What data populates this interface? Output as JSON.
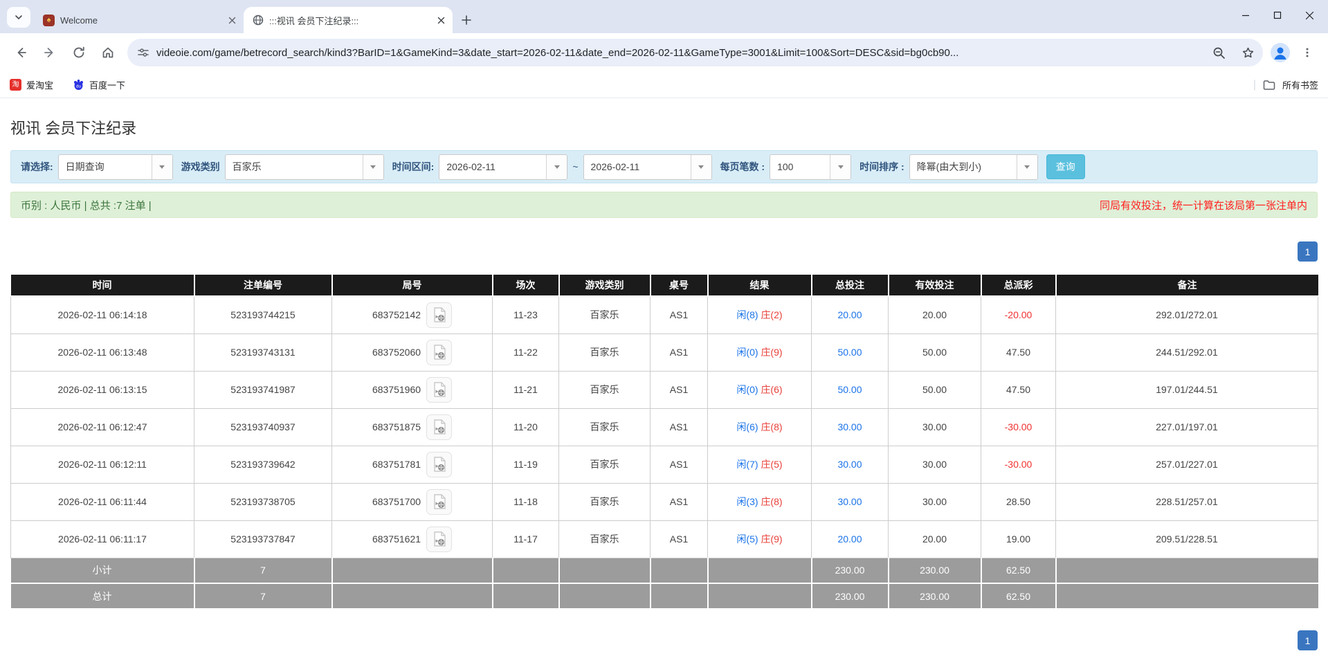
{
  "colors": {
    "accent_blue": "#1a73e8",
    "table_header_bg": "#1b1b1b",
    "footer_gray": "#9c9c9c",
    "filter_bar_bg": "#d9edf7",
    "summary_bar_bg": "#dff0d8",
    "summary_text_green": "#3c763d",
    "notice_red": "#ff2020",
    "result_player_blue": "#1a73e8",
    "result_banker_red": "#e8403a",
    "negative_payout_red": "#f03030",
    "search_button_blue": "#5bc0de",
    "pagination_blue": "#3a76c0"
  },
  "browser": {
    "tabs": [
      {
        "title": "Welcome",
        "favicon": "casino-card-logo"
      },
      {
        "title": ":::视讯 会员下注纪录:::",
        "favicon": "globe"
      }
    ],
    "url": "videoie.com/game/betrecord_search/kind3?BarID=1&GameKind=3&date_start=2026-02-11&date_end=2026-02-11&GameType=3001&Limit=100&Sort=DESC&sid=bg0cb90...",
    "bookmarks": [
      {
        "label": "爱淘宝",
        "icon": "taobao"
      },
      {
        "label": "百度一下",
        "icon": "baidu"
      }
    ],
    "baidu_icon_text": "du",
    "taobao_icon_text": "淘",
    "all_bookmarks_label": "所有书签"
  },
  "page": {
    "title": "视讯 会员下注纪录",
    "filters": {
      "select_label": "请选择:",
      "select_value": "日期查询",
      "game_label": "游戏类别",
      "game_value": "百家乐",
      "range_label": "时间区间:",
      "range_start": "2026-02-11",
      "range_separator": "~",
      "range_end": "2026-02-11",
      "per_page_label": "每页笔数 :",
      "per_page_value": "100",
      "sort_label": "时间排序 :",
      "sort_value": "降幂(由大到小)",
      "search_button": "查询"
    },
    "summary": {
      "left": "币别 : 人民币 | 总共 :7 注单 |",
      "right": "同局有效投注，统一计算在该局第一张注单内"
    },
    "pagination": {
      "page": "1"
    },
    "table": {
      "headers": [
        "时间",
        "注单编号",
        "局号",
        "场次",
        "游戏类别",
        "桌号",
        "结果",
        "总投注",
        "有效投注",
        "总派彩",
        "备注"
      ],
      "rows": [
        {
          "time": "2026-02-11 06:14:18",
          "bet_id": "523193744215",
          "round_id": "683752142",
          "session": "11-23",
          "game": "百家乐",
          "table_no": "AS1",
          "result_player": "闲(8)",
          "result_banker": "庄(2)",
          "total_bet": "20.00",
          "valid_bet": "20.00",
          "payout": "-20.00",
          "note": "292.01/272.01"
        },
        {
          "time": "2026-02-11 06:13:48",
          "bet_id": "523193743131",
          "round_id": "683752060",
          "session": "11-22",
          "game": "百家乐",
          "table_no": "AS1",
          "result_player": "闲(0)",
          "result_banker": "庄(9)",
          "total_bet": "50.00",
          "valid_bet": "50.00",
          "payout": "47.50",
          "note": "244.51/292.01"
        },
        {
          "time": "2026-02-11 06:13:15",
          "bet_id": "523193741987",
          "round_id": "683751960",
          "session": "11-21",
          "game": "百家乐",
          "table_no": "AS1",
          "result_player": "闲(0)",
          "result_banker": "庄(6)",
          "total_bet": "50.00",
          "valid_bet": "50.00",
          "payout": "47.50",
          "note": "197.01/244.51"
        },
        {
          "time": "2026-02-11 06:12:47",
          "bet_id": "523193740937",
          "round_id": "683751875",
          "session": "11-20",
          "game": "百家乐",
          "table_no": "AS1",
          "result_player": "闲(6)",
          "result_banker": "庄(8)",
          "total_bet": "30.00",
          "valid_bet": "30.00",
          "payout": "-30.00",
          "note": "227.01/197.01"
        },
        {
          "time": "2026-02-11 06:12:11",
          "bet_id": "523193739642",
          "round_id": "683751781",
          "session": "11-19",
          "game": "百家乐",
          "table_no": "AS1",
          "result_player": "闲(7)",
          "result_banker": "庄(5)",
          "total_bet": "30.00",
          "valid_bet": "30.00",
          "payout": "-30.00",
          "note": "257.01/227.01"
        },
        {
          "time": "2026-02-11 06:11:44",
          "bet_id": "523193738705",
          "round_id": "683751700",
          "session": "11-18",
          "game": "百家乐",
          "table_no": "AS1",
          "result_player": "闲(3)",
          "result_banker": "庄(8)",
          "total_bet": "30.00",
          "valid_bet": "30.00",
          "payout": "28.50",
          "note": "228.51/257.01"
        },
        {
          "time": "2026-02-11 06:11:17",
          "bet_id": "523193737847",
          "round_id": "683751621",
          "session": "11-17",
          "game": "百家乐",
          "table_no": "AS1",
          "result_player": "闲(5)",
          "result_banker": "庄(9)",
          "total_bet": "20.00",
          "valid_bet": "20.00",
          "payout": "19.00",
          "note": "209.51/228.51"
        }
      ],
      "footer": [
        {
          "label": "小计",
          "count": "7",
          "total_bet": "230.00",
          "valid_bet": "230.00",
          "payout": "62.50"
        },
        {
          "label": "总计",
          "count": "7",
          "total_bet": "230.00",
          "valid_bet": "230.00",
          "payout": "62.50"
        }
      ]
    }
  }
}
